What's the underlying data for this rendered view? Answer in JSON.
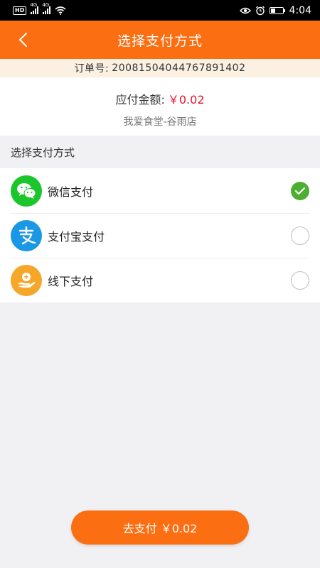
{
  "status_bar": {
    "hd_badge": "HD",
    "network_1": "4G",
    "network_2": "4G",
    "time": "4:04"
  },
  "header": {
    "title": "选择支付方式",
    "back_icon": "back-arrow-icon"
  },
  "order": {
    "label": "订单号:",
    "number": "20081504044767891402"
  },
  "amount": {
    "label": "应付金额:",
    "value": "￥0.02",
    "store": "我爱食堂-谷雨店"
  },
  "section": {
    "title": "选择支付方式"
  },
  "payment_methods": [
    {
      "label": "微信支付",
      "icon": "wechat-icon",
      "icon_color": "#1cc52c",
      "selected": true
    },
    {
      "label": "支付宝支付",
      "icon": "alipay-icon",
      "icon_color": "#1a98e5",
      "selected": false
    },
    {
      "label": "线下支付",
      "icon": "offline-pay-icon",
      "icon_color": "#f6a629",
      "selected": false
    }
  ],
  "pay_button": {
    "label": "去支付  ￥0.02"
  },
  "colors": {
    "accent": "#fb6e11",
    "price": "#e8162c",
    "check": "#4caf32"
  }
}
